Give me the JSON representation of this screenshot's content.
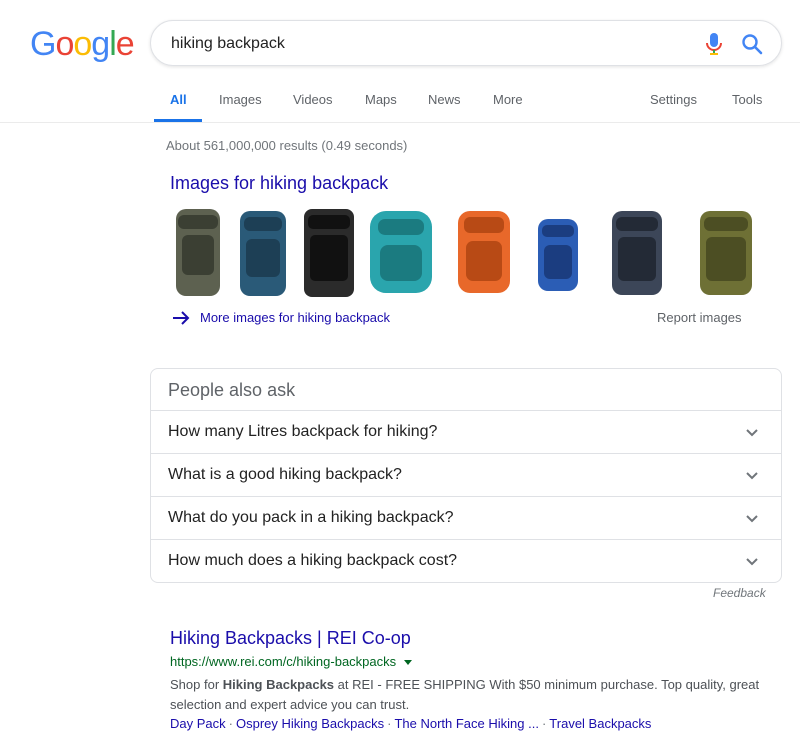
{
  "logo": {
    "letters": [
      "G",
      "o",
      "o",
      "g",
      "l",
      "e"
    ],
    "colors": [
      "#4285f4",
      "#ea4335",
      "#fbbc05",
      "#4285f4",
      "#34a853",
      "#ea4335"
    ]
  },
  "search": {
    "query": "hiking backpack"
  },
  "tabs": {
    "all": "All",
    "images": "Images",
    "videos": "Videos",
    "maps": "Maps",
    "news": "News",
    "more": "More",
    "settings": "Settings",
    "tools": "Tools"
  },
  "stats": "About 561,000,000 results (0.49 seconds)",
  "images_block": {
    "heading": "Images for hiking backpack",
    "thumbnails": [
      {
        "main": "#5d6150",
        "accent": "#3b3f33"
      },
      {
        "main": "#2a5a78",
        "accent": "#1d3f55"
      },
      {
        "main": "#2b2b2b",
        "accent": "#111111"
      },
      {
        "main": "#2aa5ad",
        "accent": "#1b7b80"
      },
      {
        "main": "#e8682a",
        "accent": "#b84a15"
      },
      {
        "main": "#2b5db5",
        "accent": "#1b3d80"
      },
      {
        "main": "#3c4658",
        "accent": "#232a36"
      },
      {
        "main": "#6e7035",
        "accent": "#4c4e23"
      }
    ],
    "more_link": "More images for hiking backpack",
    "report": "Report images"
  },
  "people_also_ask": {
    "title": "People also ask",
    "questions": [
      "How many Litres backpack for hiking?",
      "What is a good hiking backpack?",
      "What do you pack in a hiking backpack?",
      "How much does a hiking backpack cost?"
    ],
    "feedback": "Feedback"
  },
  "result": {
    "title": "Hiking Backpacks | REI Co-op",
    "url": "https://www.rei.com/c/hiking-backpacks",
    "snippet_pre": "Shop for ",
    "snippet_bold": "Hiking Backpacks",
    "snippet_post": " at REI - FREE SHIPPING With $50 minimum purchase. Top quality, great selection and expert advice you can trust.",
    "sitelinks": [
      "Day Pack",
      "Osprey Hiking Backpacks",
      "The North Face Hiking ...",
      "Travel Backpacks"
    ],
    "sitelink_separator": "·"
  },
  "colors": {
    "link": "#1a0dab",
    "url_green": "#006621",
    "tab_active": "#1a73e8"
  }
}
